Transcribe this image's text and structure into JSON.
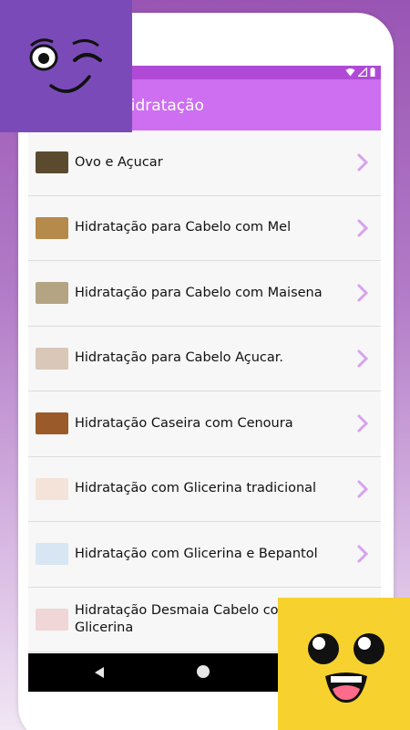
{
  "app": {
    "title": "Hidratação"
  },
  "status": {
    "time": ""
  },
  "items": [
    {
      "label": "Ovo e Açucar",
      "thumb": "#5a4b2e"
    },
    {
      "label": "Hidratação para Cabelo com Mel",
      "thumb": "#b58a4a"
    },
    {
      "label": "Hidratação para Cabelo com Maisena",
      "thumb": "#b5a483"
    },
    {
      "label": "Hidratação para Cabelo Açucar.",
      "thumb": "#d9c7b8"
    },
    {
      "label": "Hidratação Caseira com Cenoura",
      "thumb": "#9a5a2a"
    },
    {
      "label": "Hidratação com Glicerina tradicional",
      "thumb": "#f3e3d8"
    },
    {
      "label": "Hidratação com Glicerina e Bepantol",
      "thumb": "#d7e6f2"
    },
    {
      "label": "Hidratação Desmaia Cabelo com Glicerina",
      "thumb": "#f0d6d6"
    }
  ],
  "colors": {
    "status_bar": "#b04ad6",
    "app_bar": "#cd6ff0",
    "chevron": "#d7a2ef",
    "wink_bg": "#7a4bb8",
    "happy_bg": "#f7d22e"
  },
  "icons": {
    "chevron": "chevron-right-icon",
    "back": "nav-back-icon",
    "home": "nav-home-icon",
    "wifi": "wifi-icon",
    "signal": "signal-icon",
    "battery": "battery-icon"
  }
}
